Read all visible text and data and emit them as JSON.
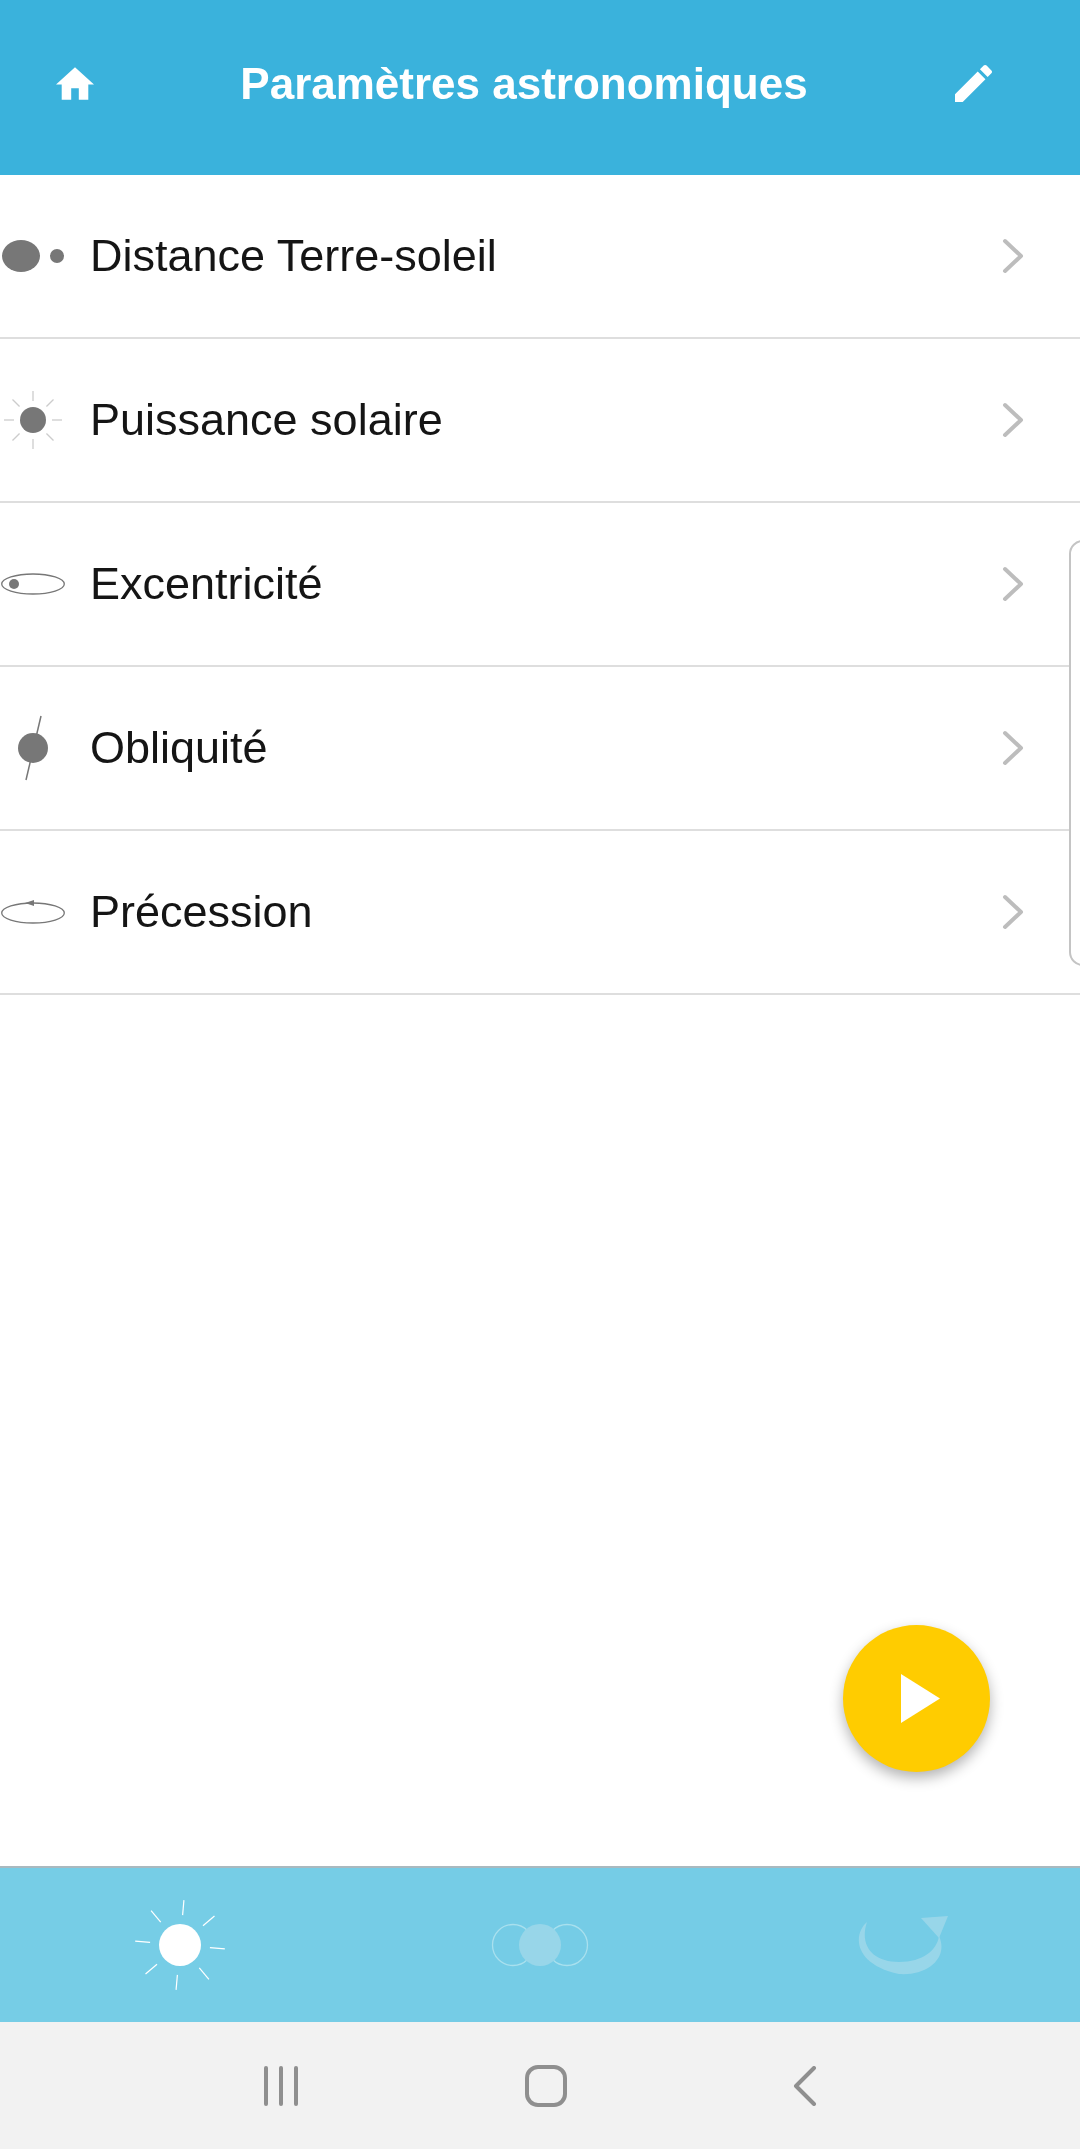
{
  "header": {
    "title": "Paramètres astronomiques"
  },
  "items": [
    {
      "label": "Distance Terre-soleil"
    },
    {
      "label": "Puissance solaire"
    },
    {
      "label": "Excentricité"
    },
    {
      "label": "Obliquité"
    },
    {
      "label": "Précession"
    }
  ],
  "bottom_nav": [
    {
      "selected": true
    },
    {
      "selected": false
    },
    {
      "selected": false
    }
  ]
}
